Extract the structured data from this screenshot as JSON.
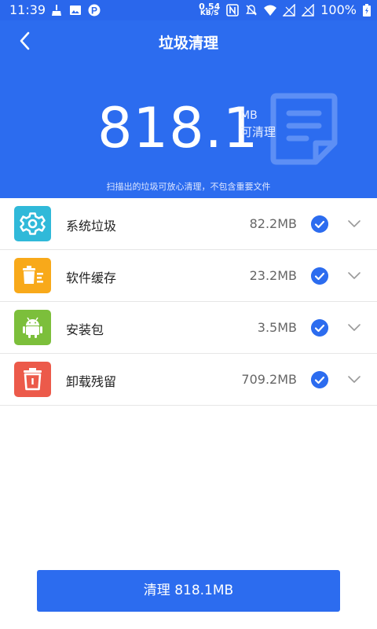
{
  "status_bar": {
    "time": "11:39",
    "net_speed_value": "0.54",
    "net_speed_unit": "KB/S",
    "battery_text": "100%",
    "icons": [
      "broom-icon",
      "image-icon",
      "p-app-icon",
      "nfc-icon",
      "mute-icon",
      "wifi-icon",
      "no-sim-icon",
      "no-sim-icon",
      "battery-charging-icon"
    ]
  },
  "header": {
    "title": "垃圾清理",
    "back_icon": "chevron-left-icon"
  },
  "summary": {
    "size_value": "818.1",
    "size_unit": "MB",
    "size_label": "可清理",
    "note": "扫描出的垃圾可放心清理，不包含重要文件",
    "decor_icon": "document-icon"
  },
  "items": [
    {
      "label": "系统垃圾",
      "size": "82.2MB",
      "icon": "gear-icon",
      "color": "#30b9d9",
      "checked": true
    },
    {
      "label": "软件缓存",
      "size": "23.2MB",
      "icon": "trash-list-icon",
      "color": "#f8a91a",
      "checked": true
    },
    {
      "label": "安装包",
      "size": "3.5MB",
      "icon": "android-icon",
      "color": "#7cbf3b",
      "checked": true
    },
    {
      "label": "卸载残留",
      "size": "709.2MB",
      "icon": "trash-icon",
      "color": "#ec5a4a",
      "checked": true
    }
  ],
  "action": {
    "clean_label": "清理 818.1MB"
  },
  "colors": {
    "primary": "#2c6cef",
    "status_bar": "#2a67ec"
  }
}
